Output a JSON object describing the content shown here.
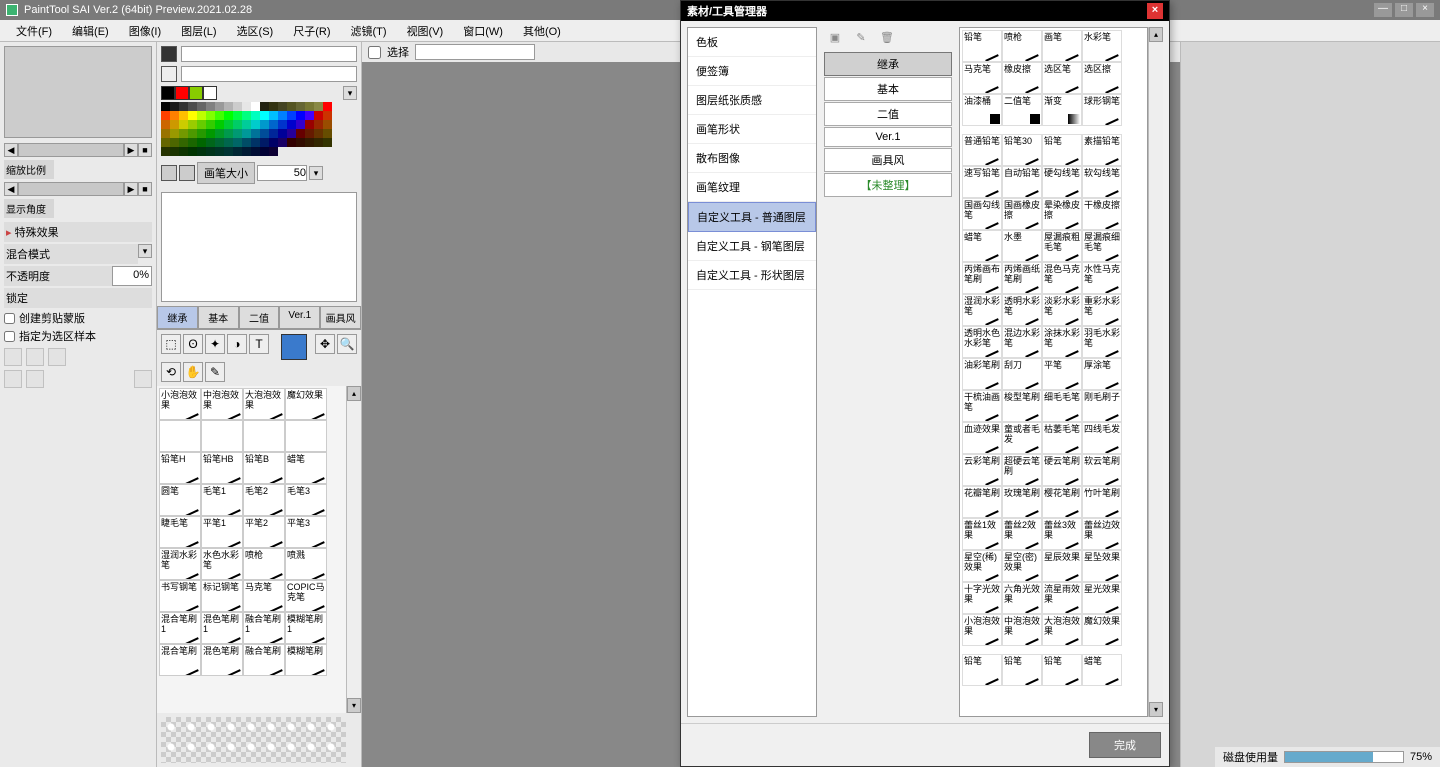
{
  "title": "PaintTool SAI Ver.2 (64bit) Preview.2021.02.28",
  "menu": [
    "文件(F)",
    "编辑(E)",
    "图像(I)",
    "图层(L)",
    "选区(S)",
    "尺子(R)",
    "滤镜(T)",
    "视图(V)",
    "窗口(W)",
    "其他(O)"
  ],
  "left": {
    "zoom_label": "缩放比例",
    "angle_label": "显示角度",
    "effects": "特殊效果",
    "blend_label": "混合模式",
    "opacity_label": "不透明度",
    "opacity_val": "0%",
    "lock_label": "锁定",
    "clip_label": "创建剪贴蒙版",
    "sample_label": "指定为选区样本"
  },
  "tools": {
    "select_label": "选择",
    "brush_size_label": "画笔大小",
    "brush_size_val": "50",
    "tabs": [
      "继承",
      "基本",
      "二值",
      "Ver.1",
      "画具风"
    ],
    "brushes": [
      "小泡泡效果",
      "中泡泡效果",
      "大泡泡效果",
      "魔幻效果",
      "",
      "",
      "",
      "",
      "铅笔H",
      "铅笔HB",
      "铅笔B",
      "蜡笔",
      "圆笔",
      "毛笔1",
      "毛笔2",
      "毛笔3",
      "睫毛笔",
      "平笔1",
      "平笔2",
      "平笔3",
      "湿润水彩笔",
      "水色水彩笔",
      "喷枪",
      "喷溅",
      "书写钢笔",
      "标记钢笔",
      "马克笔",
      "COPIC马克笔",
      "混合笔刷1",
      "混色笔刷1",
      "融合笔刷1",
      "模糊笔刷1",
      "混合笔刷",
      "混色笔刷",
      "融合笔刷",
      "模糊笔刷"
    ]
  },
  "modal": {
    "title": "素材/工具管理器",
    "categories": [
      "色板",
      "便签簿",
      "图层纸张质感",
      "画笔形状",
      "散布图像",
      "画笔纹理",
      "自定义工具 - 普通图层",
      "自定义工具 - 钢笔图层",
      "自定义工具 - 形状图层"
    ],
    "selected_cat": 6,
    "groups": [
      "继承",
      "基本",
      "二值",
      "Ver.1",
      "画具风",
      "【未整理】"
    ],
    "brushes_r": [
      "铅笔",
      "喷枪",
      "画笔",
      "水彩笔",
      "马克笔",
      "橡皮擦",
      "选区笔",
      "选区擦",
      "油漆桶",
      "二值笔",
      "渐变",
      "球形钢笔",
      "_gap",
      "普通铅笔",
      "铅笔30",
      "铅笔",
      "素描铅笔",
      "速写铅笔",
      "自动铅笔",
      "硬勾线笔",
      "软勾线笔",
      "国画勾线笔",
      "国画橡皮擦",
      "晕染橡皮擦",
      "干橡皮擦",
      "蜡笔",
      "水墨",
      "屋漏痕粗毛笔",
      "屋漏痕细毛笔",
      "丙烯画布笔刷",
      "丙烯画纸笔刷",
      "混色马克笔",
      "水性马克笔",
      "湿润水彩笔",
      "透明水彩笔",
      "淡彩水彩笔",
      "重彩水彩笔",
      "透明水色水彩笔",
      "混边水彩笔",
      "涂抹水彩笔",
      "羽毛水彩笔",
      "油彩笔刷",
      "刮刀",
      "平笔",
      "厚涂笔",
      "干梳油画笔",
      "梭型笔刷",
      "细毛毛笔",
      "刚毛刷子",
      "血迹效果",
      "童或者毛发",
      "枯萎毛笔",
      "四线毛发",
      "云彩笔刷",
      "超硬云笔刷",
      "硬云笔刷",
      "软云笔刷",
      "花瓣笔刷",
      "玫瑰笔刷",
      "樱花笔刷",
      "竹叶笔刷",
      "蕾丝1效果",
      "蕾丝2效果",
      "蕾丝3效果",
      "蕾丝边效果",
      "星空(稀)效果",
      "星空(密)效果",
      "星辰效果",
      "星坠效果",
      "十字光效果",
      "六角光效果",
      "流星雨效果",
      "星光效果",
      "小泡泡效果",
      "中泡泡效果",
      "大泡泡效果",
      "魔幻效果",
      "_gap",
      "铅笔",
      "铅笔",
      "铅笔",
      "蜡笔"
    ],
    "done": "完成"
  },
  "status": {
    "disk_label": "磁盘使用量",
    "disk_val": "75%"
  },
  "colors": {
    "swatch_row": [
      "#000000",
      "#ff0000",
      "#88cc00",
      "#ffffff"
    ],
    "palette": [
      "#000000",
      "#1a1a1a",
      "#333333",
      "#4d4d4d",
      "#666666",
      "#808080",
      "#999999",
      "#b3b3b3",
      "#cccccc",
      "#e6e6e6",
      "#ffffff",
      "#221",
      "#331",
      "#442",
      "#552",
      "#663",
      "#773",
      "#884",
      "#ff0000",
      "#ff4000",
      "#ff8000",
      "#ffbf00",
      "#ffff00",
      "#bfff00",
      "#80ff00",
      "#40ff00",
      "#00ff00",
      "#00ff40",
      "#00ff80",
      "#00ffbf",
      "#00ffff",
      "#00bfff",
      "#0080ff",
      "#0040ff",
      "#0000ff",
      "#4000ff",
      "#cc0000",
      "#cc3300",
      "#cc6600",
      "#cc9900",
      "#cccc00",
      "#99cc00",
      "#66cc00",
      "#33cc00",
      "#00cc00",
      "#00cc33",
      "#00cc66",
      "#00cc99",
      "#00cccc",
      "#0099cc",
      "#0066cc",
      "#0033cc",
      "#0000cc",
      "#3300cc",
      "#990000",
      "#992600",
      "#994d00",
      "#997300",
      "#999900",
      "#739900",
      "#4d9900",
      "#269900",
      "#009900",
      "#009926",
      "#00994d",
      "#009973",
      "#009999",
      "#007399",
      "#004d99",
      "#002699",
      "#000099",
      "#260099",
      "#660000",
      "#661a00",
      "#663300",
      "#664d00",
      "#666600",
      "#4d6600",
      "#336600",
      "#1a6600",
      "#006600",
      "#00661a",
      "#006633",
      "#00664d",
      "#006666",
      "#004d66",
      "#003366",
      "#001a66",
      "#000066",
      "#1a0066",
      "#330000",
      "#330d00",
      "#331a00",
      "#332600",
      "#333300",
      "#263300",
      "#1a3300",
      "#0d3300",
      "#003300",
      "#00330d",
      "#00331a",
      "#003326",
      "#003333",
      "#002633",
      "#001a33",
      "#000d33",
      "#000033",
      "#0d0033"
    ]
  }
}
